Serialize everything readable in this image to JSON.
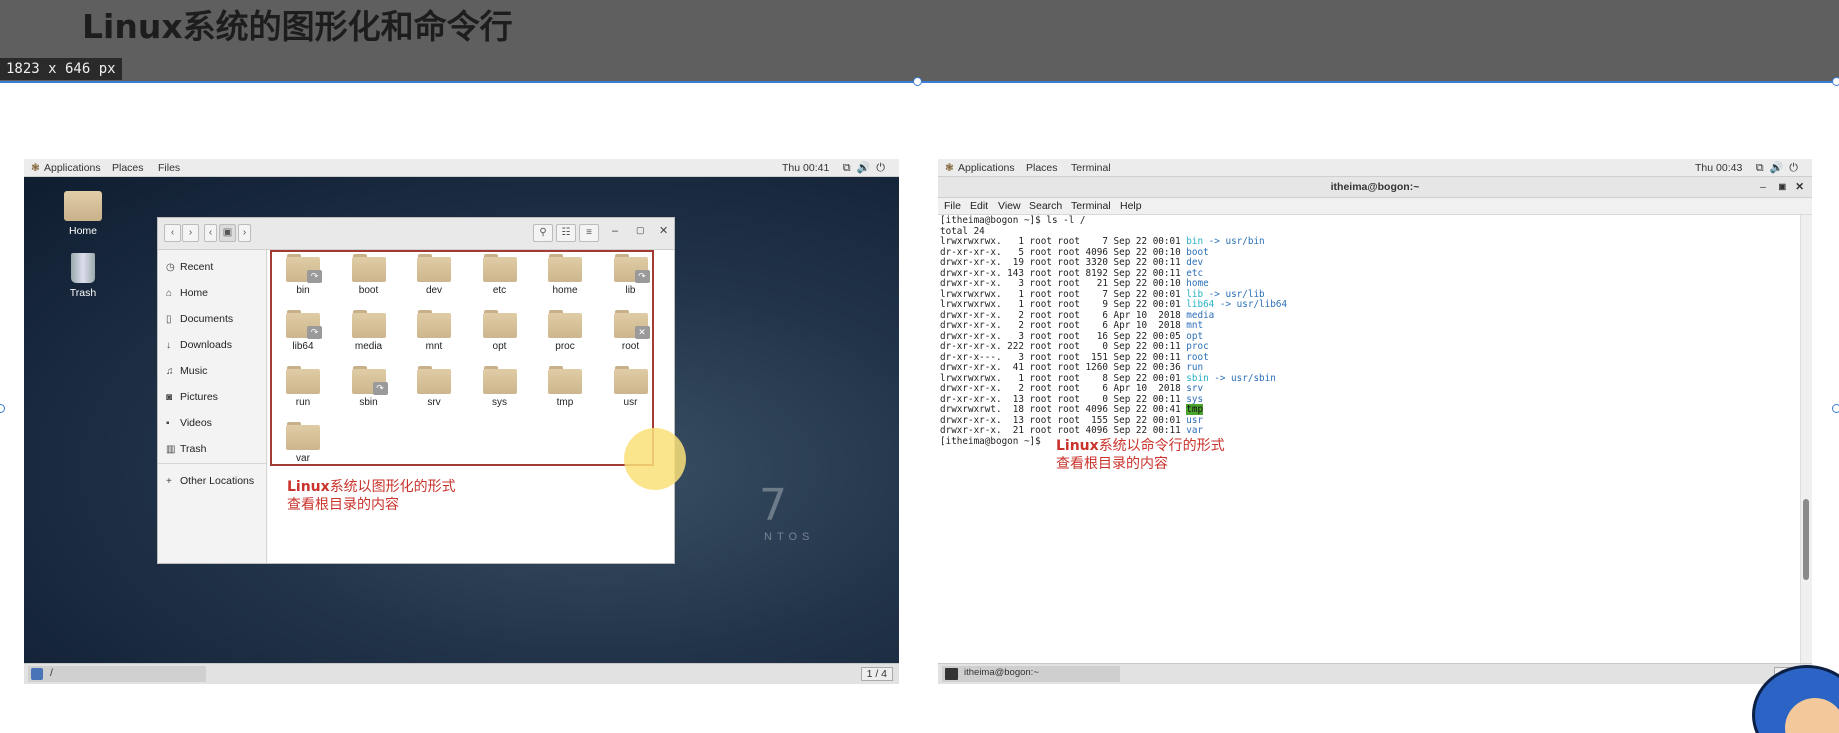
{
  "slide": {
    "title": "Linux系统的图形化和命令行",
    "dimension_badge": "1823 x 646  px",
    "accent_color": "#3a7bd5"
  },
  "gui": {
    "topbar": {
      "applications": "Applications",
      "places": "Places",
      "app": "Files",
      "clock": "Thu 00:41"
    },
    "desktop_icons": [
      {
        "label": "Home",
        "icon": "home-folder-icon"
      },
      {
        "label": "Trash",
        "icon": "trash-icon"
      }
    ],
    "sidebar": [
      {
        "label": "Recent",
        "icon": "clock-icon"
      },
      {
        "label": "Home",
        "icon": "home-icon"
      },
      {
        "label": "Documents",
        "icon": "document-icon"
      },
      {
        "label": "Downloads",
        "icon": "download-icon"
      },
      {
        "label": "Music",
        "icon": "music-icon"
      },
      {
        "label": "Pictures",
        "icon": "camera-icon"
      },
      {
        "label": "Videos",
        "icon": "video-icon"
      },
      {
        "label": "Trash",
        "icon": "trash-icon"
      },
      {
        "label": "Other Locations",
        "icon": "plus-icon"
      }
    ],
    "folders": [
      {
        "name": "bin",
        "link": true
      },
      {
        "name": "boot"
      },
      {
        "name": "dev"
      },
      {
        "name": "etc"
      },
      {
        "name": "home"
      },
      {
        "name": "lib",
        "link": true
      },
      {
        "name": "lib64",
        "link": true
      },
      {
        "name": "media"
      },
      {
        "name": "mnt"
      },
      {
        "name": "opt"
      },
      {
        "name": "proc"
      },
      {
        "name": "root",
        "locked": true
      },
      {
        "name": "run"
      },
      {
        "name": "sbin",
        "link": true
      },
      {
        "name": "srv"
      },
      {
        "name": "sys"
      },
      {
        "name": "tmp"
      },
      {
        "name": "usr"
      },
      {
        "name": "var"
      }
    ],
    "note_bold": "Linux",
    "note_line1_rest": "系统以图形化的形式",
    "note_line2": "查看根目录的内容",
    "watermark": "NTOS",
    "watermark_digit": "7",
    "bottombar": {
      "path": "/",
      "workspace": "1 / 4"
    }
  },
  "cli": {
    "topbar": {
      "applications": "Applications",
      "places": "Places",
      "app": "Terminal",
      "clock": "Thu 00:43"
    },
    "window_title": "itheima@bogon:~",
    "menu": [
      "File",
      "Edit",
      "View",
      "Search",
      "Terminal",
      "Help"
    ],
    "lines": [
      {
        "text": "[itheima@bogon ~]$ ls -l /"
      },
      {
        "text": "total 24"
      },
      {
        "text": "lrwxrwxrwx.   1 root root    7 Sep 22 00:01 ",
        "name": "bin",
        "kind": "ln",
        "target": " -> usr/bin"
      },
      {
        "text": "dr-xr-xr-x.   5 root root 4096 Sep 22 00:10 ",
        "name": "boot",
        "kind": "nm"
      },
      {
        "text": "drwxr-xr-x.  19 root root 3320 Sep 22 00:11 ",
        "name": "dev",
        "kind": "nm"
      },
      {
        "text": "drwxr-xr-x. 143 root root 8192 Sep 22 00:11 ",
        "name": "etc",
        "kind": "nm"
      },
      {
        "text": "drwxr-xr-x.   3 root root   21 Sep 22 00:10 ",
        "name": "home",
        "kind": "nm"
      },
      {
        "text": "lrwxrwxrwx.   1 root root    7 Sep 22 00:01 ",
        "name": "lib",
        "kind": "ln",
        "target": " -> usr/lib"
      },
      {
        "text": "lrwxrwxrwx.   1 root root    9 Sep 22 00:01 ",
        "name": "lib64",
        "kind": "ln",
        "target": " -> usr/lib64"
      },
      {
        "text": "drwxr-xr-x.   2 root root    6 Apr 10  2018 ",
        "name": "media",
        "kind": "nm"
      },
      {
        "text": "drwxr-xr-x.   2 root root    6 Apr 10  2018 ",
        "name": "mnt",
        "kind": "nm"
      },
      {
        "text": "drwxr-xr-x.   3 root root   16 Sep 22 00:05 ",
        "name": "opt",
        "kind": "nm"
      },
      {
        "text": "dr-xr-xr-x. 222 root root    0 Sep 22 00:11 ",
        "name": "proc",
        "kind": "nm"
      },
      {
        "text": "dr-xr-x---.   3 root root  151 Sep 22 00:11 ",
        "name": "root",
        "kind": "nm"
      },
      {
        "text": "drwxr-xr-x.  41 root root 1260 Sep 22 00:36 ",
        "name": "run",
        "kind": "nm"
      },
      {
        "text": "lrwxrwxrwx.   1 root root    8 Sep 22 00:01 ",
        "name": "sbin",
        "kind": "ln",
        "target": " -> usr/sbin"
      },
      {
        "text": "drwxr-xr-x.   2 root root    6 Apr 10  2018 ",
        "name": "srv",
        "kind": "nm"
      },
      {
        "text": "dr-xr-xr-x.  13 root root    0 Sep 22 00:11 ",
        "name": "sys",
        "kind": "nm"
      },
      {
        "text": "drwxrwxrwt.  18 root root 4096 Sep 22 00:41 ",
        "name": "tmp",
        "kind": "hl"
      },
      {
        "text": "drwxr-xr-x.  13 root root  155 Sep 22 00:01 ",
        "name": "usr",
        "kind": "nm"
      },
      {
        "text": "drwxr-xr-x.  21 root root 4096 Sep 22 00:11 ",
        "name": "var",
        "kind": "nm"
      },
      {
        "text": "[itheima@bogon ~]$ "
      }
    ],
    "note_bold": "Linux",
    "note_line1_rest": "系统以命令行的形式",
    "note_line2": "查看根目录的内容",
    "bottombar": {
      "task": "itheima@bogon:~",
      "workspace": "1 / 4"
    }
  }
}
